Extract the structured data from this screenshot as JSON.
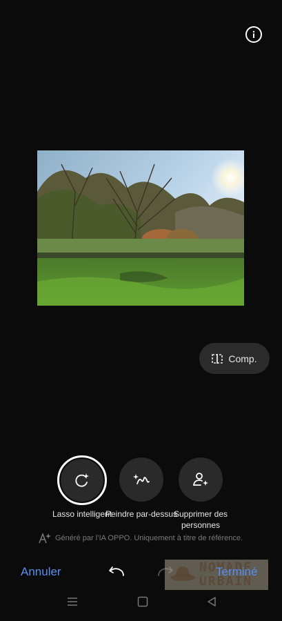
{
  "top": {
    "info_icon": "info-icon"
  },
  "comp": {
    "label": "Comp.",
    "icon": "compare-icon"
  },
  "tools": [
    {
      "label": "Lasso intelligent",
      "icon": "smart-lasso-icon",
      "selected": true
    },
    {
      "label": "Peindre par-dessus",
      "icon": "paint-over-icon",
      "selected": false
    },
    {
      "label": "Supprimer des personnes",
      "icon": "remove-people-icon",
      "selected": false
    }
  ],
  "ai_note": "Généré par l’IA OPPO. Uniquement à titre de référence.",
  "bottom": {
    "cancel_label": "Annuler",
    "done_label": "Terminé",
    "watermark_line1": "NOMADE",
    "watermark_line2": "URBAIN"
  },
  "colors": {
    "accent": "#5b8def",
    "background": "#0b0b0b"
  }
}
